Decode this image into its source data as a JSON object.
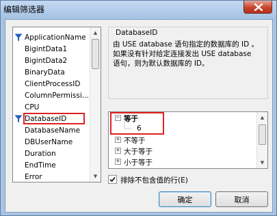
{
  "window": {
    "title": "编辑筛选器"
  },
  "columns": {
    "items": [
      {
        "label": "ApplicationName",
        "filtered": true
      },
      {
        "label": "BigintData1",
        "filtered": false
      },
      {
        "label": "BigintData2",
        "filtered": false
      },
      {
        "label": "BinaryData",
        "filtered": false
      },
      {
        "label": "ClientProcessID",
        "filtered": false
      },
      {
        "label": "ColumnPermissi...",
        "filtered": false
      },
      {
        "label": "CPU",
        "filtered": false
      },
      {
        "label": "DatabaseID",
        "filtered": true,
        "selected": true
      },
      {
        "label": "DatabaseName",
        "filtered": false
      },
      {
        "label": "DBUserName",
        "filtered": false
      },
      {
        "label": "Duration",
        "filtered": false
      },
      {
        "label": "EndTime",
        "filtered": false
      },
      {
        "label": "Error",
        "filtered": false
      }
    ]
  },
  "description": {
    "title": "DatabaseID",
    "text": "由 USE database 语句指定的数据库的 ID 。如果没有针对给定连接发出 USE database 语句，则为默认数据库的 ID。"
  },
  "tree": {
    "rows": [
      {
        "label": "等于",
        "expander": "−",
        "level": 0,
        "bold": true
      },
      {
        "label": "6",
        "expander": "",
        "level": 1,
        "bold": false
      },
      {
        "label": "不等于",
        "expander": "+",
        "level": 0,
        "bold": false
      },
      {
        "label": "大于等于",
        "expander": "+",
        "level": 0,
        "bold": false
      },
      {
        "label": "小于等于",
        "expander": "+",
        "level": 0,
        "bold": false
      }
    ]
  },
  "options": {
    "exclude_null_label": "排除不包含值的行(E)",
    "exclude_null_checked": true
  },
  "buttons": {
    "ok_label": "确定",
    "cancel_label": "取消"
  },
  "colors": {
    "selection_highlight": "#e02020",
    "filter_icon": "#2060c0"
  }
}
